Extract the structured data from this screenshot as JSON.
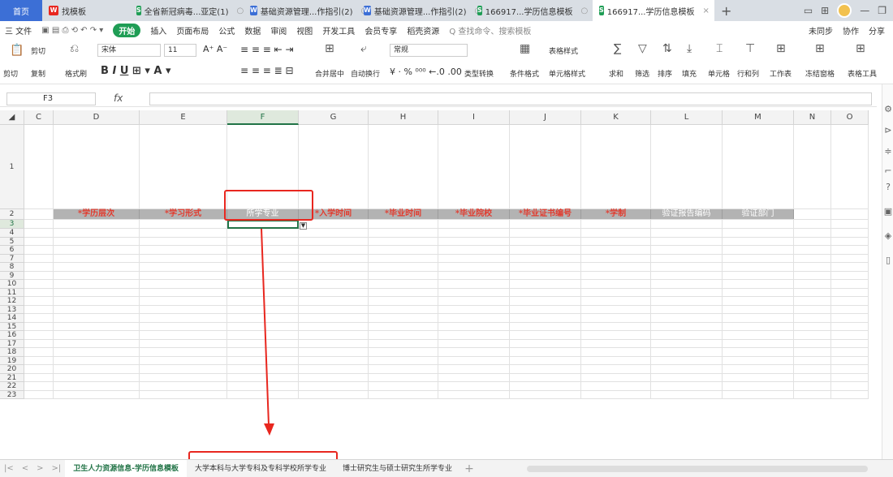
{
  "tabs": [
    {
      "label": "首页",
      "kind": "home"
    },
    {
      "label": "找模板",
      "icon": "wps-logo-icon"
    },
    {
      "label": "全省新冠病毒...亚定(1)",
      "icon": "sheet-icon"
    },
    {
      "label": "基础资源管理...作指引(2)",
      "icon": "doc-icon"
    },
    {
      "label": "基础资源管理...作指引(2)",
      "icon": "doc-icon"
    },
    {
      "label": "166917...学历信息模板",
      "icon": "sheet-icon"
    },
    {
      "label": "166917...学历信息模板",
      "icon": "sheet-icon",
      "active": true
    }
  ],
  "menu": {
    "file": "三 文件",
    "start": "开始",
    "items": [
      "插入",
      "页面布局",
      "公式",
      "数据",
      "审阅",
      "视图",
      "开发工具",
      "会员专享",
      "稻壳资源"
    ],
    "search": "Q 查找命令、搜索模板",
    "right": [
      "未同步",
      "协作",
      "分享"
    ]
  },
  "ribbon": {
    "clipboard": [
      "剪切",
      "粘贴",
      "复制",
      "格式刷"
    ],
    "font_name": "宋体",
    "font_size": "11",
    "merge": "合并居中",
    "wrap": "自动换行",
    "number_format": "常规",
    "type_convert": "类型转换",
    "cond_format": "条件格式",
    "table_style": "表格样式",
    "cell_style": "单元格样式",
    "sum": "求和",
    "filter": "筛选",
    "sort": "排序",
    "fill": "填充",
    "cells": "单元格",
    "rowcol": "行和列",
    "worksheet": "工作表",
    "freeze": "冻结窗格",
    "tools": "表格工具"
  },
  "formula_bar": {
    "cell_ref": "F3",
    "fx": "fx",
    "value": ""
  },
  "columns": [
    "C",
    "D",
    "E",
    "F",
    "G",
    "H",
    "I",
    "J",
    "K",
    "L",
    "M",
    "N",
    "O"
  ],
  "selected_column": "F",
  "rows": [
    "1",
    "2",
    "3",
    "4",
    "5",
    "6",
    "7",
    "8",
    "9",
    "10",
    "11",
    "12",
    "13",
    "14",
    "15",
    "16",
    "17",
    "18",
    "19",
    "20",
    "21",
    "22",
    "23"
  ],
  "header_row": [
    {
      "col": "D",
      "text": "*学历层次",
      "required": true
    },
    {
      "col": "E",
      "text": "*学习形式",
      "required": true
    },
    {
      "col": "F",
      "text": "所学专业",
      "required": false
    },
    {
      "col": "G",
      "text": "*入学时间",
      "required": true
    },
    {
      "col": "H",
      "text": "*毕业时间",
      "required": true
    },
    {
      "col": "I",
      "text": "*毕业院校",
      "required": true
    },
    {
      "col": "J",
      "text": "*毕业证书编号",
      "required": true
    },
    {
      "col": "K",
      "text": "*学制",
      "required": true
    },
    {
      "col": "L",
      "text": "验证报告编码",
      "required": false
    },
    {
      "col": "M",
      "text": "验证部门",
      "required": false
    }
  ],
  "sheet_tabs": [
    {
      "label": "卫生人力资源信息-学历信息模板",
      "active": true
    },
    {
      "label": "大学本科与大学专科及专科学校所学专业"
    },
    {
      "label": "博士研究生与硕士研究生所学专业"
    }
  ],
  "annotation_color": "#e8271f"
}
